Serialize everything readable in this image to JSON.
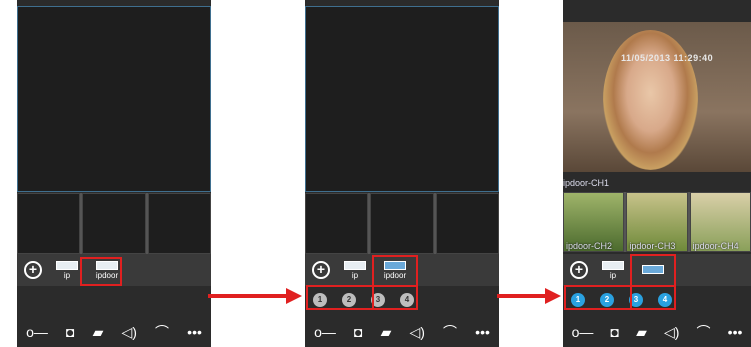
{
  "devices": [
    {
      "label": "ip"
    },
    {
      "label": "ipdoor"
    }
  ],
  "channels": [
    "1",
    "2",
    "3",
    "4"
  ],
  "screen3": {
    "timestamp": "11/05/2013 11:29:40",
    "main_label": "ipdoor-CH1",
    "sub_labels": [
      "ipdoor-CH2",
      "ipdoor-CH3",
      "ipdoor-CH4"
    ]
  },
  "toolbar_icons": [
    "key-icon",
    "camera-icon",
    "video-record-icon",
    "speaker-icon",
    "phone-icon",
    "more-icon"
  ],
  "toolbar_glyphs": [
    "o—",
    "◘",
    "▰",
    "◁)",
    "⌒",
    "•••"
  ],
  "colors": {
    "highlight": "#e02020",
    "active_channel": "#2aa1e0"
  }
}
